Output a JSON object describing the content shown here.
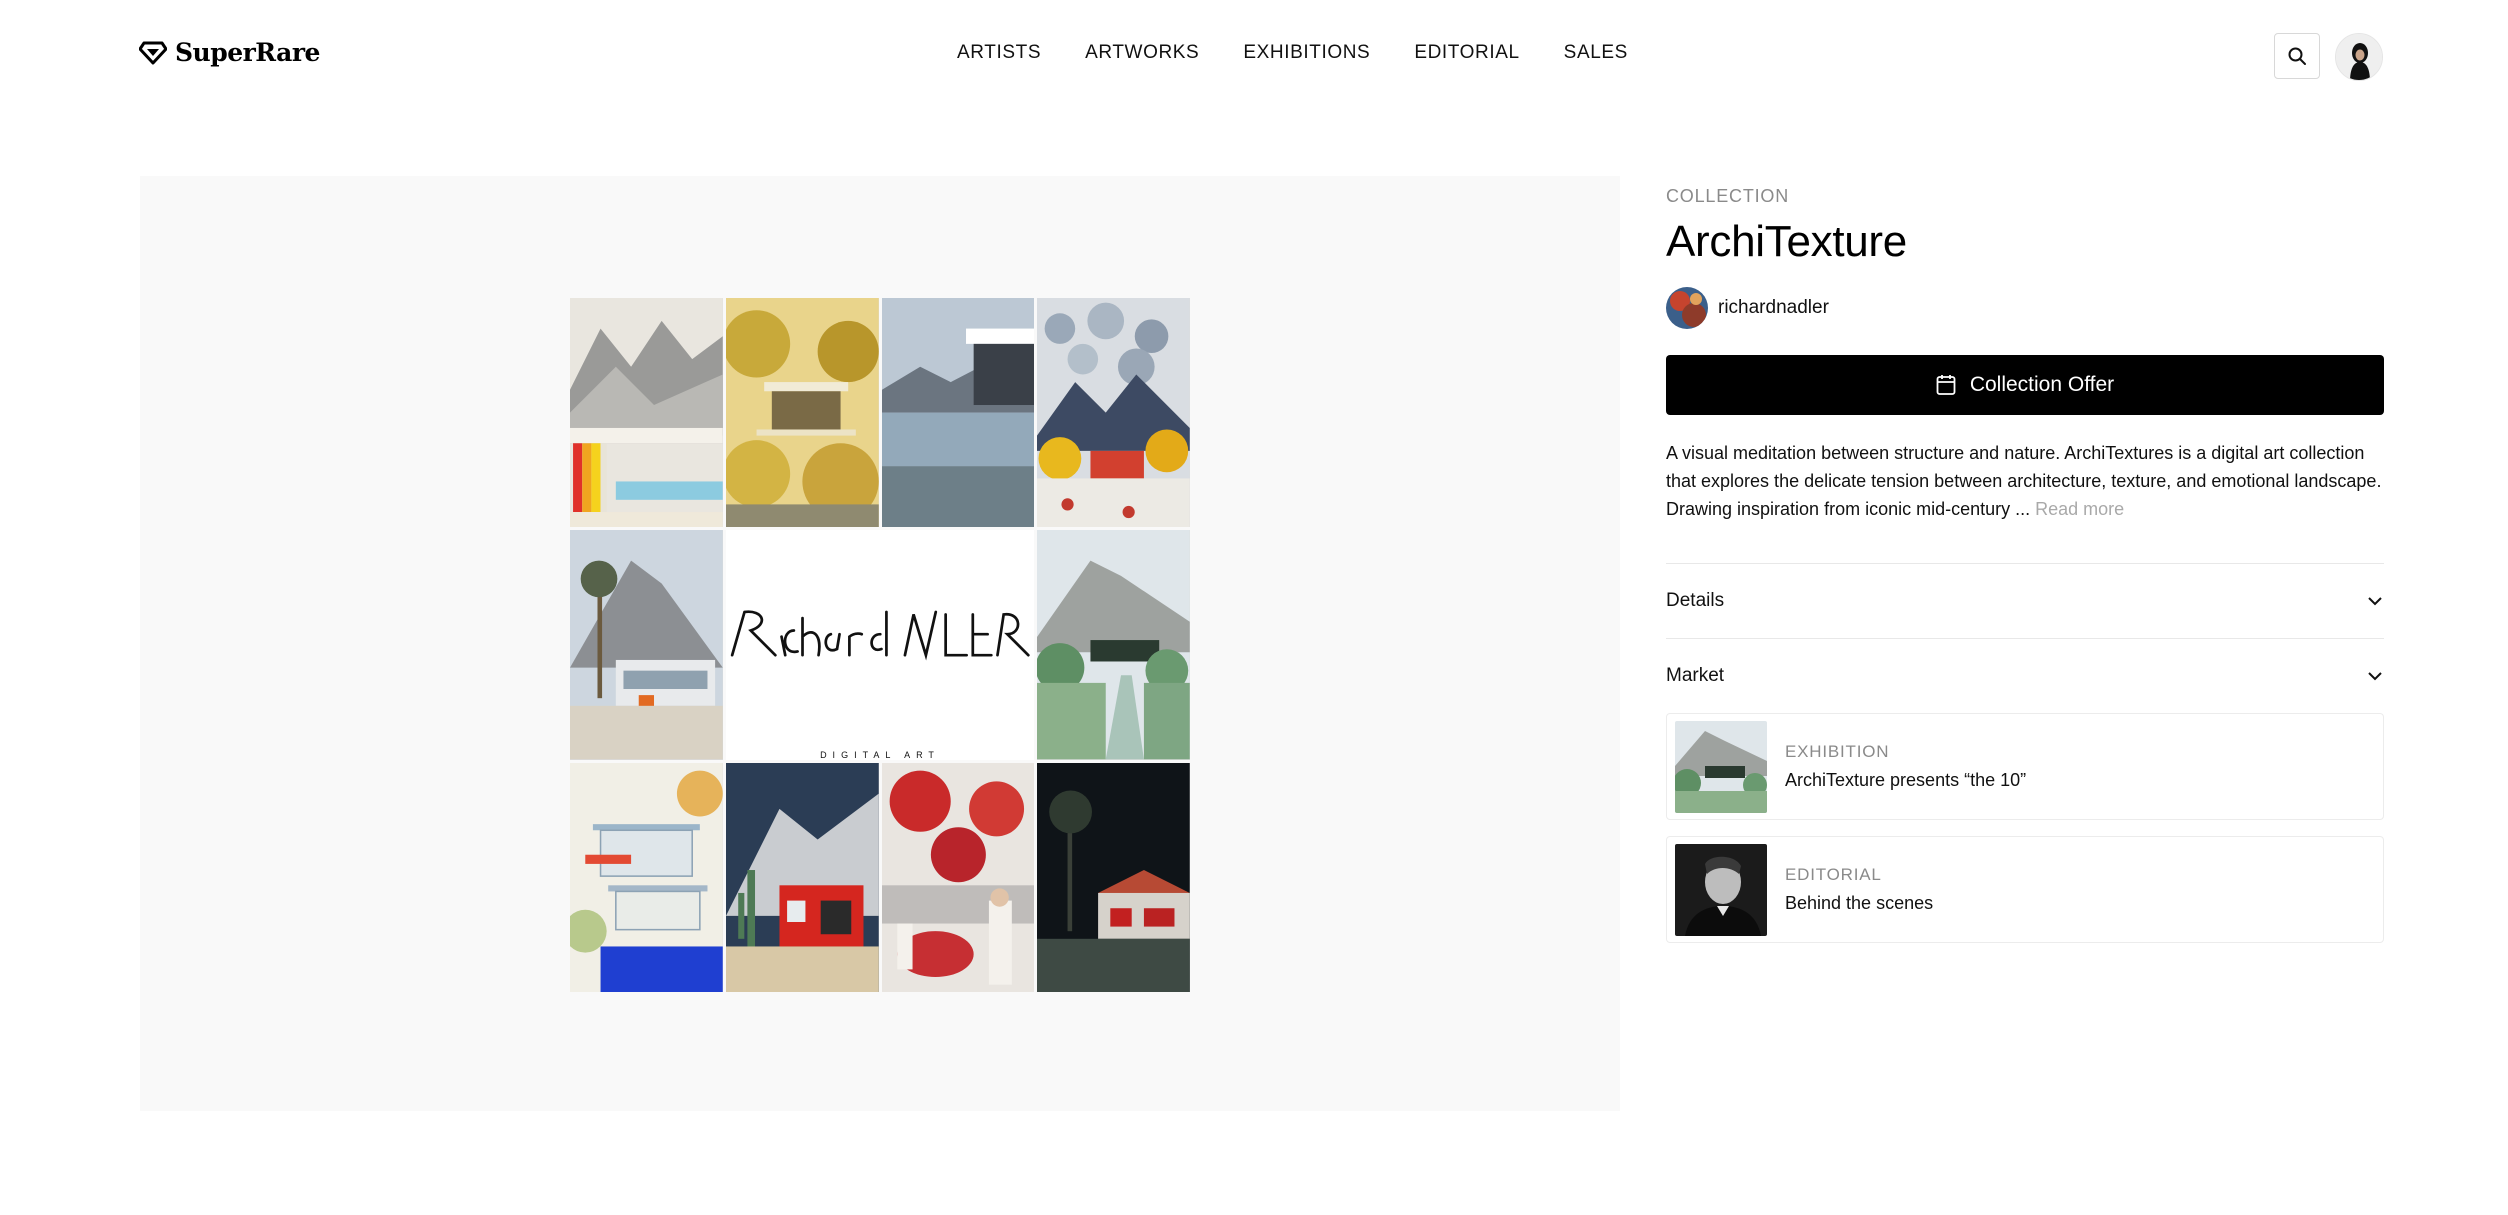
{
  "brand": {
    "name": "SuperRare"
  },
  "nav": {
    "items": [
      "ARTISTS",
      "ARTWORKS",
      "EXHIBITIONS",
      "EDITORIAL",
      "SALES"
    ]
  },
  "header": {
    "search_icon": "search-icon"
  },
  "collection": {
    "eyebrow": "COLLECTION",
    "title": "ArchiTexture",
    "creator": "richardnadler",
    "offer_label": "Collection Offer",
    "description": "A visual meditation between structure and nature. ArchiTextures is a digital art collection that explores the delicate tension between architecture, texture, and emotional landscape. Drawing inspiration from iconic mid-century ...",
    "read_more": "Read more"
  },
  "artwork_logo": {
    "signature": "Richard Nadler",
    "subtitle": "DIGITAL ART"
  },
  "accordions": [
    "Details",
    "Market"
  ],
  "related": [
    {
      "kind": "EXHIBITION",
      "title": "ArchiTexture presents “the 10”"
    },
    {
      "kind": "EDITORIAL",
      "title": "Behind the scenes"
    }
  ],
  "colors": {
    "accent": "#000000",
    "muted": "#8a8a8a",
    "panel_bg": "#f9f9f9"
  }
}
